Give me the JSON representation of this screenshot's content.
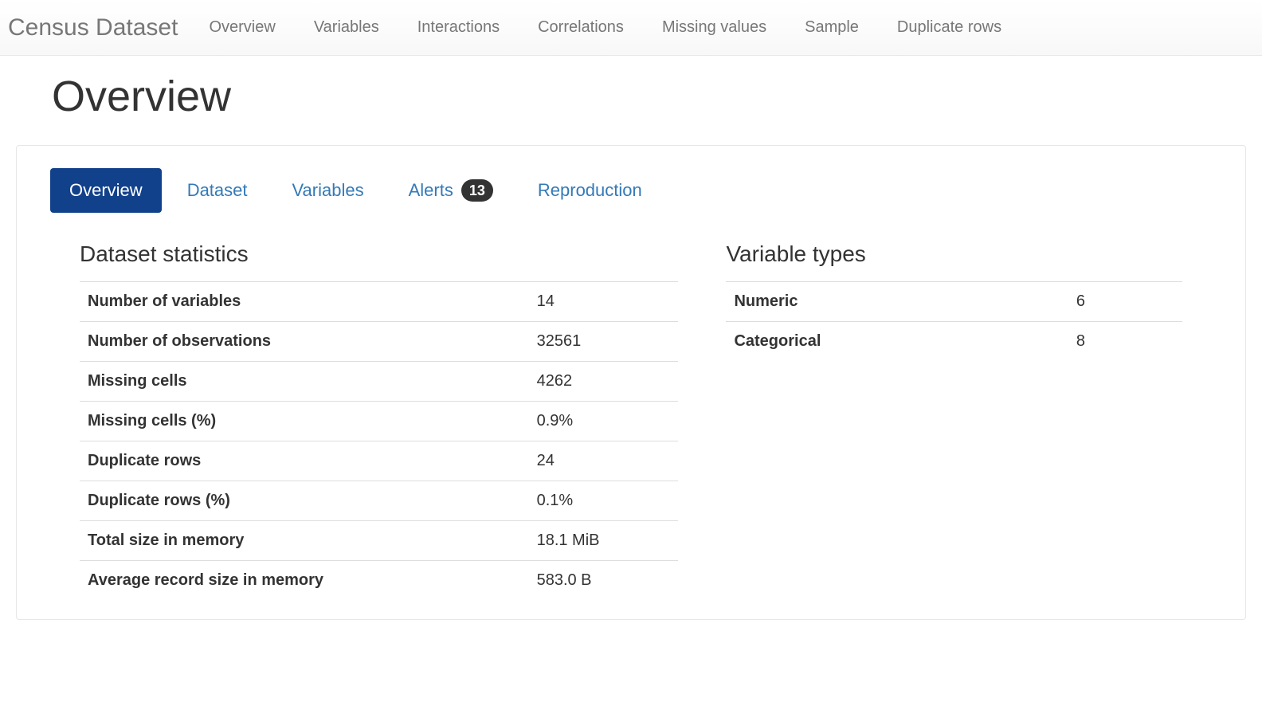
{
  "navbar": {
    "brand": "Census Dataset",
    "items": [
      "Overview",
      "Variables",
      "Interactions",
      "Correlations",
      "Missing values",
      "Sample",
      "Duplicate rows"
    ]
  },
  "page_title": "Overview",
  "tabs": [
    {
      "label": "Overview",
      "active": true
    },
    {
      "label": "Dataset",
      "active": false
    },
    {
      "label": "Variables",
      "active": false
    },
    {
      "label": "Alerts",
      "active": false,
      "badge": "13"
    },
    {
      "label": "Reproduction",
      "active": false
    }
  ],
  "dataset_statistics": {
    "title": "Dataset statistics",
    "rows": [
      {
        "label": "Number of variables",
        "value": "14"
      },
      {
        "label": "Number of observations",
        "value": "32561"
      },
      {
        "label": "Missing cells",
        "value": "4262"
      },
      {
        "label": "Missing cells (%)",
        "value": "0.9%"
      },
      {
        "label": "Duplicate rows",
        "value": "24"
      },
      {
        "label": "Duplicate rows (%)",
        "value": "0.1%"
      },
      {
        "label": "Total size in memory",
        "value": "18.1 MiB"
      },
      {
        "label": "Average record size in memory",
        "value": "583.0 B"
      }
    ]
  },
  "variable_types": {
    "title": "Variable types",
    "rows": [
      {
        "label": "Numeric",
        "value": "6"
      },
      {
        "label": "Categorical",
        "value": "8"
      }
    ]
  }
}
